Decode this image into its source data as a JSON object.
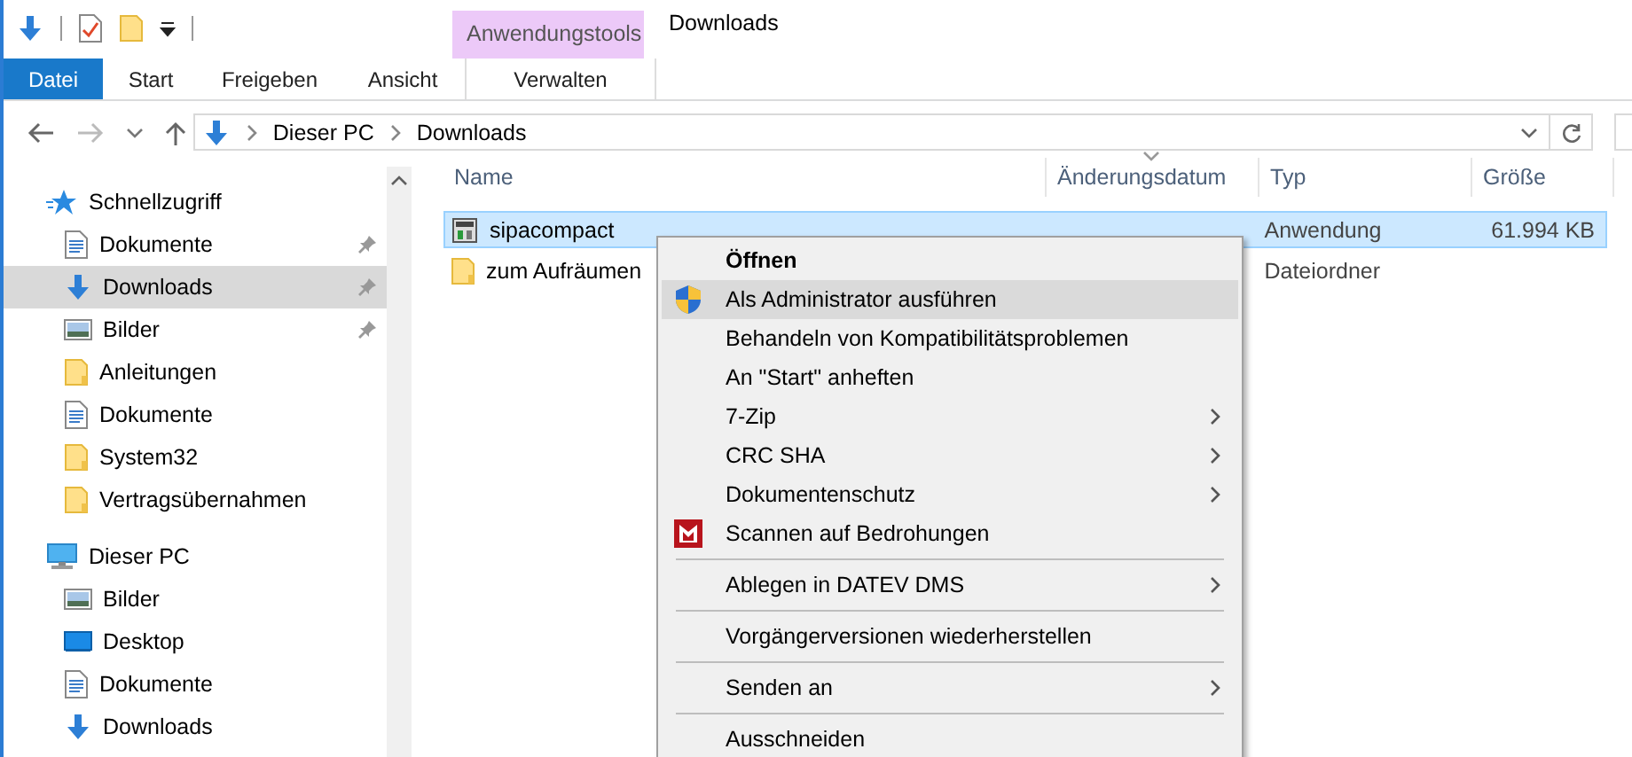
{
  "window": {
    "title": "Downloads"
  },
  "contextual_tab_group": {
    "label": "Anwendungstools"
  },
  "ribbon_tabs": [
    {
      "label": "Datei",
      "kind": "file"
    },
    {
      "label": "Start",
      "kind": "normal"
    },
    {
      "label": "Freigeben",
      "kind": "normal"
    },
    {
      "label": "Ansicht",
      "kind": "normal"
    },
    {
      "label": "Verwalten",
      "kind": "contextual"
    }
  ],
  "address_bar": {
    "path": [
      "Dieser PC",
      "Downloads"
    ]
  },
  "nav_pane": {
    "sections": [
      {
        "label": "Schnellzugriff",
        "kind": "quick",
        "items": [
          {
            "label": "Dokumente",
            "kind": "document",
            "pinned": true,
            "selected": false
          },
          {
            "label": "Downloads",
            "kind": "download",
            "pinned": true,
            "selected": true
          },
          {
            "label": "Bilder",
            "kind": "pictures",
            "pinned": true,
            "selected": false
          },
          {
            "label": "Anleitungen",
            "kind": "folder",
            "pinned": false,
            "selected": false
          },
          {
            "label": "Dokumente",
            "kind": "document",
            "pinned": false,
            "selected": false
          },
          {
            "label": "System32",
            "kind": "folder",
            "pinned": false,
            "selected": false
          },
          {
            "label": "Vertragsübernahmen",
            "kind": "folder",
            "pinned": false,
            "selected": false
          }
        ]
      },
      {
        "label": "Dieser PC",
        "kind": "pc",
        "items": [
          {
            "label": "Bilder",
            "kind": "pictures",
            "pinned": false,
            "selected": false
          },
          {
            "label": "Desktop",
            "kind": "desktop",
            "pinned": false,
            "selected": false
          },
          {
            "label": "Dokumente",
            "kind": "document",
            "pinned": false,
            "selected": false
          },
          {
            "label": "Downloads",
            "kind": "download",
            "pinned": false,
            "selected": false
          }
        ]
      }
    ]
  },
  "file_list": {
    "columns": [
      "Name",
      "Änderungsdatum",
      "Typ",
      "Größe"
    ],
    "rows": [
      {
        "kind": "app",
        "name": "sipacompact",
        "type": "Anwendung",
        "size": "61.994 KB",
        "selected": true
      },
      {
        "kind": "folder",
        "name": "zum Aufräumen",
        "type": "Dateiordner",
        "selected": false
      }
    ]
  },
  "context_menu": {
    "items": [
      {
        "label": "Öffnen",
        "kind": "default",
        "submenu": false,
        "separator_before": false,
        "selected": false
      },
      {
        "label": "Als Administrator ausführen",
        "kind": "shield",
        "submenu": false,
        "separator_before": false,
        "selected": true
      },
      {
        "label": "Behandeln von Kompatibilitätsproblemen",
        "kind": "normal",
        "submenu": false,
        "separator_before": false,
        "selected": false
      },
      {
        "label": "An \"Start\" anheften",
        "kind": "normal",
        "submenu": false,
        "separator_before": false,
        "selected": false
      },
      {
        "label": "7-Zip",
        "kind": "normal",
        "submenu": true,
        "separator_before": false,
        "selected": false
      },
      {
        "label": "CRC SHA",
        "kind": "normal",
        "submenu": true,
        "separator_before": false,
        "selected": false
      },
      {
        "label": "Dokumentenschutz",
        "kind": "normal",
        "submenu": true,
        "separator_before": false,
        "selected": false
      },
      {
        "label": "Scannen auf Bedrohungen",
        "kind": "antivirus",
        "submenu": false,
        "separator_before": false,
        "selected": false
      },
      {
        "label": "Ablegen in DATEV DMS",
        "kind": "normal",
        "submenu": true,
        "separator_before": true,
        "selected": false
      },
      {
        "label": "Vorgängerversionen wiederherstellen",
        "kind": "normal",
        "submenu": false,
        "separator_before": true,
        "selected": false
      },
      {
        "label": "Senden an",
        "kind": "normal",
        "submenu": true,
        "separator_before": true,
        "selected": false
      },
      {
        "label": "Ausschneiden",
        "kind": "normal",
        "submenu": false,
        "separator_before": true,
        "selected": false
      }
    ]
  }
}
